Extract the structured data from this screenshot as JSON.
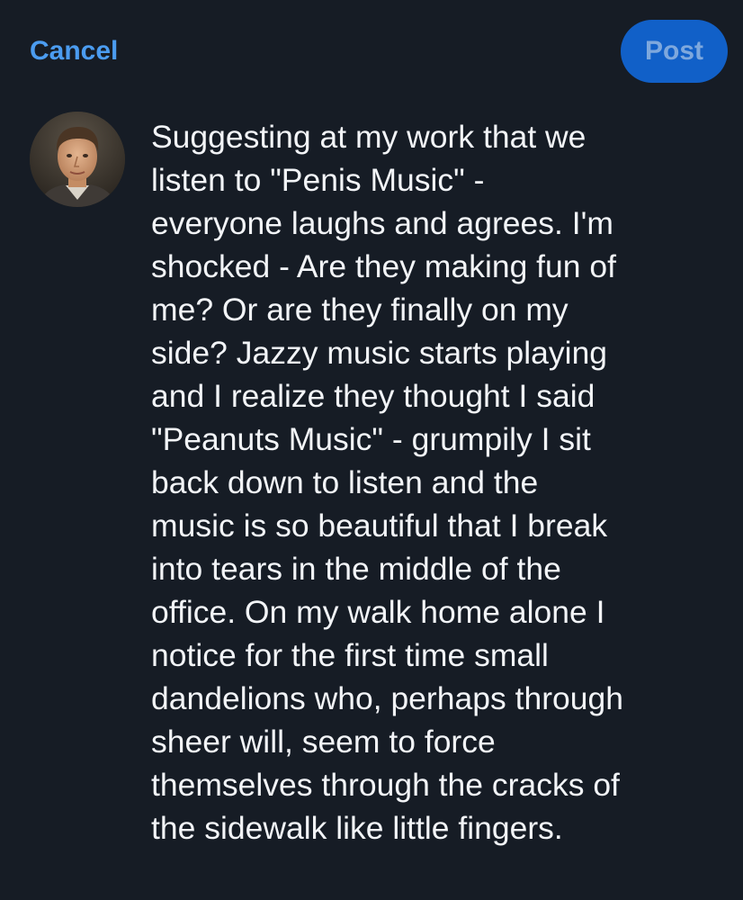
{
  "header": {
    "cancel_label": "Cancel",
    "post_label": "Post"
  },
  "composer": {
    "text": "Suggesting at my work that we\nlisten to \"Penis Music\" -\neveryone laughs and agrees. I'm\nshocked - Are they making fun of\nme? Or are they finally on my\nside? Jazzy music starts playing\nand I realize they thought I said\n\"Peanuts Music\" - grumpily I sit\nback down to listen and the\nmusic is so beautiful that I break\ninto tears in the middle of the\noffice. On my walk home alone I\nnotice for the first time small\ndandelions who, perhaps through\nsheer will, seem to force\nthemselves through the cracks of\nthe sidewalk like little fingers."
  },
  "colors": {
    "background": "#161c25",
    "cancel_text": "#4b9cf0",
    "post_button_bg": "#1160c8",
    "post_button_text": "#7ea8dd",
    "body_text": "#f2f4f7"
  }
}
